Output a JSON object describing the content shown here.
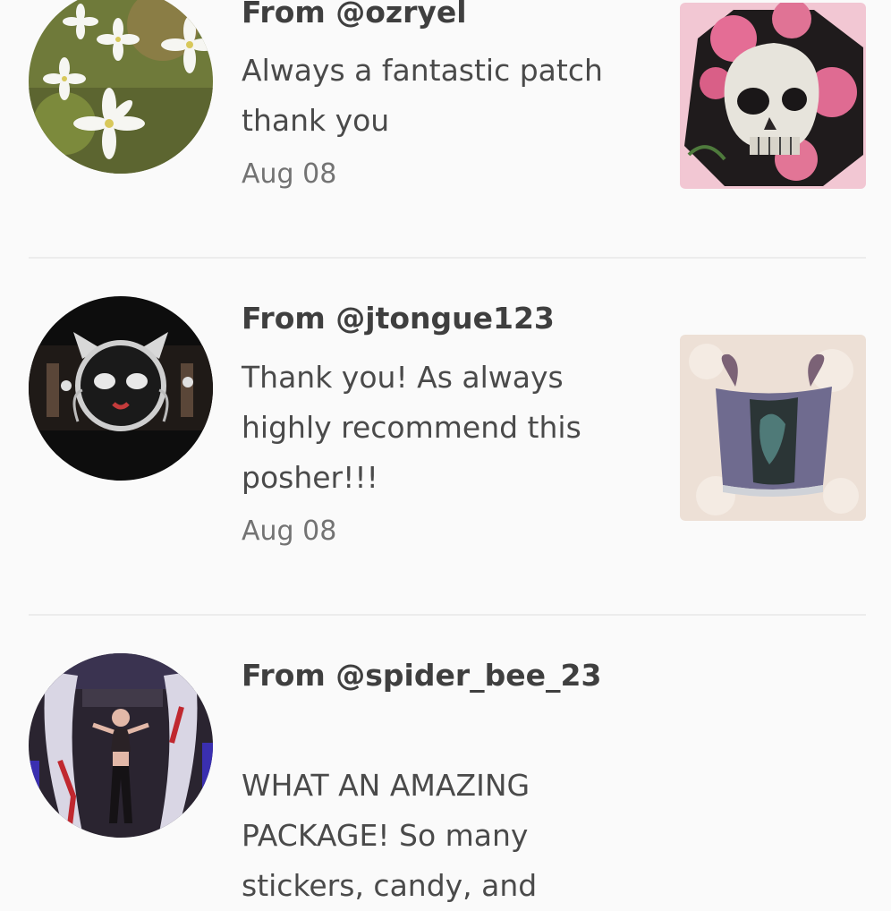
{
  "reviews": [
    {
      "from": "From @ozryel",
      "comment": "Always a fantastic patch thank you",
      "date": "Aug 08",
      "avatar_icon": "flowers-avatar",
      "thumbnail_icon": "skull-roses-patch"
    },
    {
      "from": "From @jtongue123",
      "comment": "Thank you! As always highly recommend this posher!!!",
      "date": "Aug 08",
      "avatar_icon": "catwoman-avatar",
      "thumbnail_icon": "corset-top"
    },
    {
      "from": "From @spider_bee_23",
      "comment": "WHAT AN AMAZING PACKAGE! So many stickers, candy, and",
      "avatar_icon": "dancer-avatar"
    }
  ],
  "colors": {
    "background": "#fafafa",
    "divider": "#ececec",
    "username_text": "#3f3f3f",
    "comment_text": "#4a4a4a",
    "date_text": "#737373"
  }
}
